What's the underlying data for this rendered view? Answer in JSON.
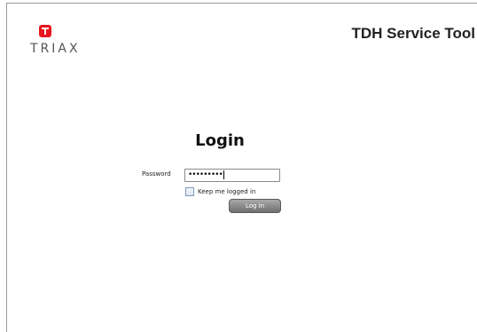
{
  "header": {
    "logo_text": "TRIAX",
    "app_title": "TDH Service Tool"
  },
  "login": {
    "heading": "Login",
    "password_label": "Password",
    "password_value": "•••••••••",
    "keep_logged_in_label": "Keep me logged in",
    "keep_logged_in_checked": false,
    "submit_label": "Log in"
  },
  "colors": {
    "brand_red": "#e8161e",
    "button_gray": "#7f7f7f"
  }
}
